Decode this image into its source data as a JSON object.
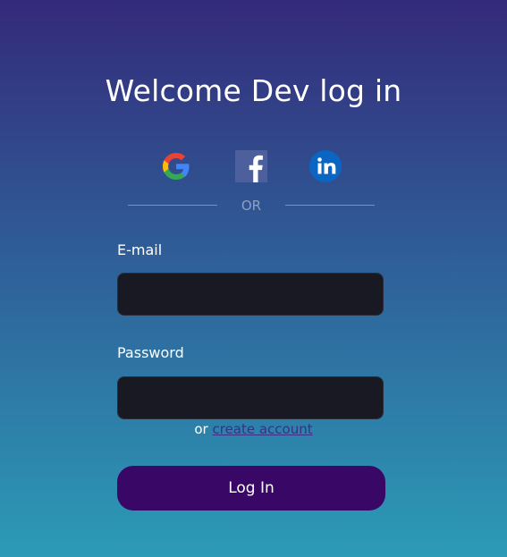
{
  "page_title": "Welcome Dev log in",
  "social": {
    "google_icon": "google-icon",
    "facebook_icon": "facebook-icon",
    "linkedin_icon": "linkedin-icon"
  },
  "divider": {
    "text": "OR"
  },
  "form": {
    "email_label": "E-mail",
    "email_value": "",
    "password_label": "Password",
    "password_value": ""
  },
  "create_account": {
    "prefix": "or",
    "link_text": "create account"
  },
  "login_button": {
    "label": "Log In"
  },
  "colors": {
    "background_top": "#342a7a",
    "background_bottom": "#2c9bb7",
    "input_bg": "#181923",
    "button_bg": "#390766",
    "link_color": "#3b2f86"
  }
}
